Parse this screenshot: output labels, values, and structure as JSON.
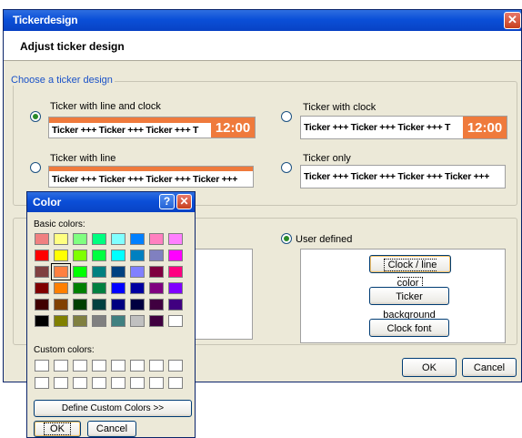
{
  "main_window": {
    "title": "Tickerdesign",
    "close_glyph": "✕",
    "heading": "Adjust ticker design",
    "design_group": {
      "label": "Choose a ticker design",
      "options": [
        {
          "label": "Ticker with line and clock",
          "checked": true,
          "ticker_text": "Ticker +++ Ticker +++ Ticker +++ T",
          "clock": "12:00"
        },
        {
          "label": "Ticker with clock",
          "checked": false,
          "ticker_text": "Ticker +++ Ticker +++ Ticker +++ T",
          "clock": "12:00"
        },
        {
          "label": "Ticker with line",
          "checked": false,
          "ticker_text": "Ticker +++ Ticker +++ Ticker +++ Ticker +++"
        },
        {
          "label": "Ticker only",
          "checked": false,
          "ticker_text": "Ticker +++ Ticker +++ Ticker +++ Ticker +++"
        }
      ]
    },
    "colors_group": {
      "user_defined_label": "User defined",
      "user_defined_checked": true,
      "buttons": [
        "Clock / line color",
        "Ticker background",
        "Clock font"
      ]
    },
    "ok_label": "OK",
    "cancel_label": "Cancel"
  },
  "color_dialog": {
    "title": "Color",
    "help_glyph": "?",
    "close_glyph": "✕",
    "basic_colors_label": "Basic colors:",
    "basic_colors": [
      [
        "#f08080",
        "#ffff80",
        "#80ff80",
        "#00ff80",
        "#80ffff",
        "#0080ff",
        "#ff80c0",
        "#ff80ff"
      ],
      [
        "#ff0000",
        "#ffff00",
        "#80ff00",
        "#00ff40",
        "#00ffff",
        "#0080c0",
        "#8080c0",
        "#ff00ff"
      ],
      [
        "#804040",
        "#ff8040",
        "#00ff00",
        "#008080",
        "#004080",
        "#8080ff",
        "#800040",
        "#ff0080"
      ],
      [
        "#800000",
        "#ff8000",
        "#008000",
        "#008040",
        "#0000ff",
        "#0000a0",
        "#800080",
        "#8000ff"
      ],
      [
        "#400000",
        "#804000",
        "#004000",
        "#004040",
        "#000080",
        "#000040",
        "#400040",
        "#400080"
      ],
      [
        "#000000",
        "#808000",
        "#808040",
        "#808080",
        "#408080",
        "#c0c0c0",
        "#400040",
        "#ffffff"
      ]
    ],
    "selected_color": "#ff8040",
    "custom_colors_label": "Custom colors:",
    "define_custom_label": "Define Custom Colors >>",
    "ok_label": "OK",
    "cancel_label": "Cancel"
  },
  "theme": {
    "titlebar_blue": "#0b4fd8",
    "ticker_orange": "#ef7a3c",
    "group_label_blue": "#1a52c8",
    "dialog_face": "#ece9d8"
  }
}
